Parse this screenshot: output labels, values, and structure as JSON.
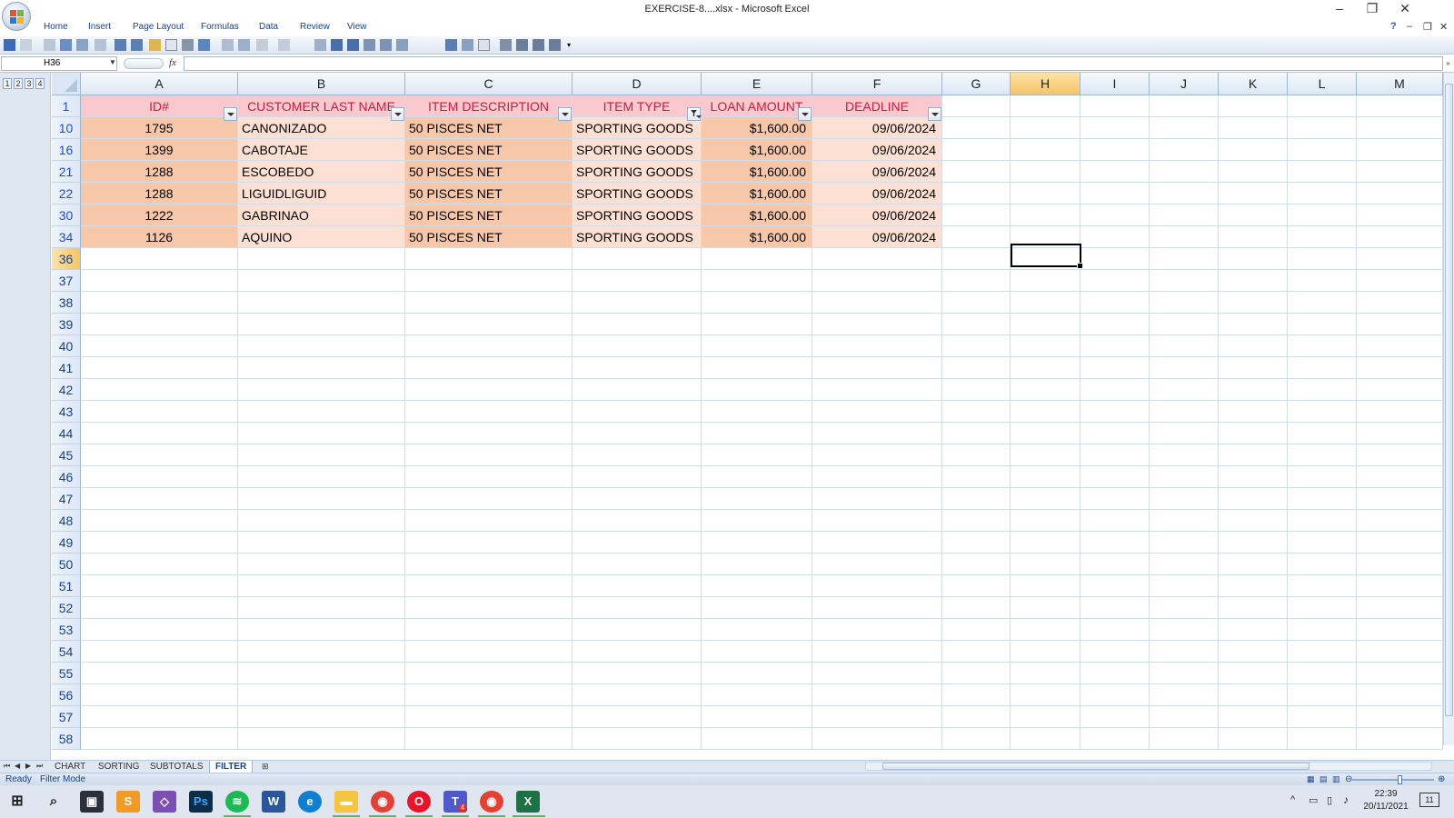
{
  "window": {
    "title": "EXERCISE-8....xlsx - Microsoft Excel",
    "controls": [
      "–",
      "❐",
      "✕"
    ],
    "doc_controls": [
      "?",
      "–",
      "❐",
      "✕"
    ]
  },
  "menu": [
    "Home",
    "Insert",
    "Page Layout",
    "Formulas",
    "Data",
    "Review",
    "View"
  ],
  "formula_bar": {
    "name_box": "H36",
    "fx_label": "fx",
    "formula": ""
  },
  "outline_levels": [
    "1",
    "2",
    "3",
    "4"
  ],
  "columns": [
    "A",
    "B",
    "C",
    "D",
    "E",
    "F",
    "G",
    "H",
    "I",
    "J",
    "K",
    "L",
    "M"
  ],
  "selected_column": "H",
  "header_row": {
    "row_number": "1",
    "cells": [
      "ID#",
      "CUSTOMER LAST NAME",
      "ITEM DESCRIPTION",
      "ITEM TYPE",
      "LOAN AMOUNT",
      "DEADLINE"
    ],
    "filter_active_column": "D"
  },
  "data_rows": [
    {
      "row": "10",
      "cells": [
        "1795",
        "CANONIZADO",
        "50 PISCES NET",
        "SPORTING GOODS",
        "$1,600.00",
        "09/06/2024"
      ]
    },
    {
      "row": "16",
      "cells": [
        "1399",
        "CABOTAJE",
        "50 PISCES NET",
        "SPORTING GOODS",
        "$1,600.00",
        "09/06/2024"
      ]
    },
    {
      "row": "21",
      "cells": [
        "1288",
        "ESCOBEDO",
        "50 PISCES NET",
        "SPORTING GOODS",
        "$1,600.00",
        "09/06/2024"
      ]
    },
    {
      "row": "22",
      "cells": [
        "1288",
        "LIGUIDLIGUID",
        "50 PISCES NET",
        "SPORTING GOODS",
        "$1,600.00",
        "09/06/2024"
      ]
    },
    {
      "row": "30",
      "cells": [
        "1222",
        "GABRINAO",
        "50 PISCES NET",
        "SPORTING GOODS",
        "$1,600.00",
        "09/06/2024"
      ]
    },
    {
      "row": "34",
      "cells": [
        "1126",
        "AQUINO",
        "50 PISCES NET",
        "SPORTING GOODS",
        "$1,600.00",
        "09/06/2024"
      ]
    }
  ],
  "empty_rows": [
    "36",
    "37",
    "38",
    "39",
    "40",
    "41",
    "42",
    "43",
    "44",
    "45",
    "46",
    "47",
    "48",
    "49",
    "50",
    "51",
    "52",
    "53",
    "54",
    "55",
    "56",
    "57",
    "58"
  ],
  "selected_row": "36",
  "sheet_tabs": [
    "CHART",
    "SORTING",
    "SUBTOTALS",
    "FILTER"
  ],
  "active_sheet": "FILTER",
  "status": {
    "ready": "Ready",
    "mode": "Filter Mode"
  },
  "taskbar": {
    "time": "22:39",
    "date": "20/11/2021",
    "notification_count": "11",
    "teams_badge": "4",
    "icons": [
      "windows-start",
      "search",
      "store",
      "sublime-text",
      "visual-studio",
      "photoshop",
      "spotify",
      "word",
      "edge",
      "file-explorer",
      "chrome",
      "opera",
      "teams",
      "chrome-profile",
      "excel"
    ]
  },
  "colors": {
    "header_fill": "#f9c9cf",
    "header_text": "#c0203e",
    "band_dark": "#f7c7a9",
    "band_light": "#fce0d3",
    "selection_highlight": "#f7c466"
  }
}
